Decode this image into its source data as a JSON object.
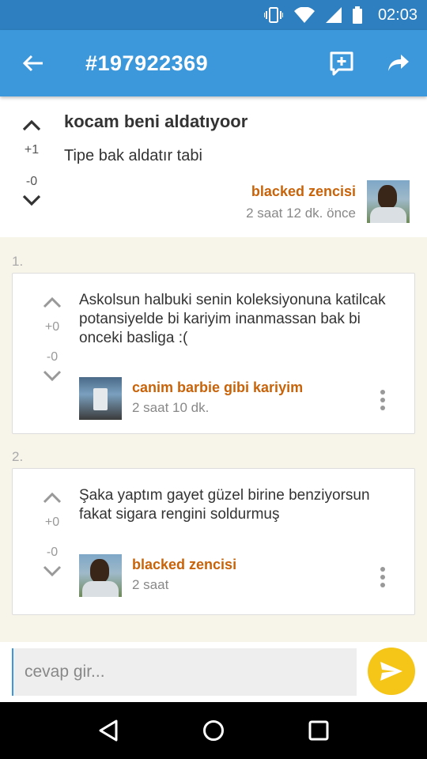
{
  "status_bar": {
    "time": "02:03",
    "icons": [
      "vibrate-icon",
      "wifi-icon",
      "signal-icon",
      "battery-icon"
    ]
  },
  "app_bar": {
    "title": "#197922369",
    "icons": [
      "back-arrow-icon",
      "add-entry-icon",
      "share-icon"
    ]
  },
  "topic": {
    "title": "kocam beni aldatıyoor",
    "body": "Tipe bak aldatır tabi",
    "plus": "+1",
    "minus": "-0",
    "author": "blacked zencisi",
    "time": "2 saat 12 dk. önce"
  },
  "entries": [
    {
      "index": "1.",
      "plus": "+0",
      "minus": "-0",
      "text": "Askolsun halbuki senin koleksiyonuna katilcak potansiyelde bi kariyim inanmassan bak bi onceki basliga :(",
      "author": "canim barbie gibi kariyim",
      "time": "2 saat 10 dk."
    },
    {
      "index": "2.",
      "plus": "+0",
      "minus": "-0",
      "text": "Şaka yaptım gayet güzel birine benziyorsun fakat sigara rengini soldurmuş",
      "author": "blacked zencisi",
      "time": "2 saat"
    }
  ],
  "reply": {
    "placeholder": "cevap gir..."
  },
  "colors": {
    "status_bar": "#2d7fbf",
    "app_bar": "#3d98db",
    "author": "#c8630a",
    "send_button": "#f5c518",
    "background": "#f7f4ea"
  },
  "nav_bar": {
    "icons": [
      "nav-back-icon",
      "nav-home-icon",
      "nav-recents-icon"
    ]
  }
}
